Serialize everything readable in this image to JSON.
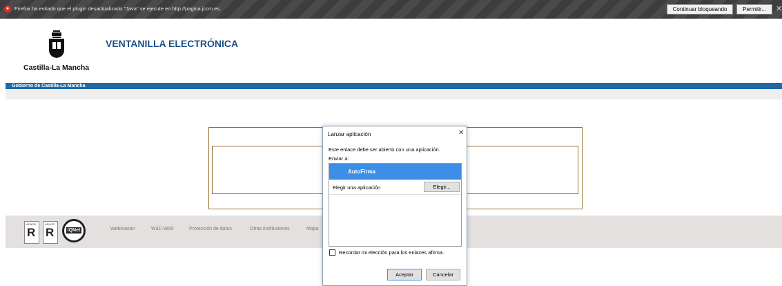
{
  "plugin_bar": {
    "message": "Firefox ha evitado que el plugin desactualizado \"Java\" se ejecute en http://pagina.jccm.es.",
    "continue_button": "Continuar bloqueando",
    "permit_button": "Permitir...",
    "close_glyph": "✕",
    "background": "#3d3d3d"
  },
  "header": {
    "logo_text": "Castilla-La Mancha",
    "site_title": "VENTANILLA ELECTRÓNICA",
    "gov_band": "Gobierno de Castilla-La Mancha",
    "title_color": "#1f4f8a",
    "band_color": "#1f6aa5"
  },
  "footer": {
    "links": [
      "Webmaster",
      "W3C-WAII",
      "Protección de datos",
      "Otras instituciones",
      "Mapa"
    ],
    "badges": [
      "AENOR",
      "AENOR"
    ],
    "iqnet": "IQNet"
  },
  "dialog": {
    "title": "Lanzar aplicación",
    "close_glyph": "✕",
    "description": "Este enlace debe ser abierto con una aplicación.",
    "send_to": "Enviar a:",
    "apps": [
      {
        "name": "AutoFirma",
        "selected": true
      }
    ],
    "choose_label": "Elegir una aplicación",
    "choose_button": "Elegir...",
    "remember_label": "Recordar mi elección para los enlaces afirma.",
    "remember_checked": false,
    "accept_button": "Aceptar",
    "cancel_button": "Cancelar",
    "selection_color": "#3d8ee6"
  }
}
